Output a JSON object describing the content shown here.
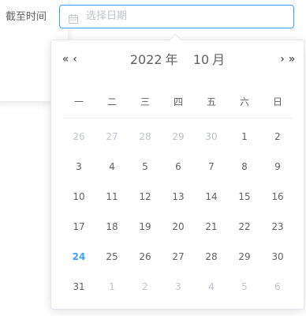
{
  "form": {
    "label": "截至时间",
    "input_placeholder": "选择日期",
    "input_icon": "calendar-icon"
  },
  "picker": {
    "year": "2022",
    "year_suffix": "年",
    "month": "10",
    "month_suffix": "月",
    "nav": {
      "prev_year": "«",
      "prev_month": "‹",
      "next_month": "›",
      "next_year": "»"
    },
    "weekdays": [
      "一",
      "二",
      "三",
      "四",
      "五",
      "六",
      "日"
    ],
    "weeks": [
      [
        {
          "d": "26",
          "t": "prev"
        },
        {
          "d": "27",
          "t": "prev"
        },
        {
          "d": "28",
          "t": "prev"
        },
        {
          "d": "29",
          "t": "prev"
        },
        {
          "d": "30",
          "t": "prev"
        },
        {
          "d": "1",
          "t": "cur"
        },
        {
          "d": "2",
          "t": "cur"
        }
      ],
      [
        {
          "d": "3",
          "t": "cur"
        },
        {
          "d": "4",
          "t": "cur"
        },
        {
          "d": "5",
          "t": "cur"
        },
        {
          "d": "6",
          "t": "cur"
        },
        {
          "d": "7",
          "t": "cur"
        },
        {
          "d": "8",
          "t": "cur"
        },
        {
          "d": "9",
          "t": "cur"
        }
      ],
      [
        {
          "d": "10",
          "t": "cur"
        },
        {
          "d": "11",
          "t": "cur"
        },
        {
          "d": "12",
          "t": "cur"
        },
        {
          "d": "13",
          "t": "cur"
        },
        {
          "d": "14",
          "t": "cur"
        },
        {
          "d": "15",
          "t": "cur"
        },
        {
          "d": "16",
          "t": "cur"
        }
      ],
      [
        {
          "d": "17",
          "t": "cur"
        },
        {
          "d": "18",
          "t": "cur"
        },
        {
          "d": "19",
          "t": "cur"
        },
        {
          "d": "20",
          "t": "cur"
        },
        {
          "d": "21",
          "t": "cur"
        },
        {
          "d": "22",
          "t": "cur"
        },
        {
          "d": "23",
          "t": "cur"
        }
      ],
      [
        {
          "d": "24",
          "t": "today"
        },
        {
          "d": "25",
          "t": "cur"
        },
        {
          "d": "26",
          "t": "cur"
        },
        {
          "d": "27",
          "t": "cur"
        },
        {
          "d": "28",
          "t": "cur"
        },
        {
          "d": "29",
          "t": "cur"
        },
        {
          "d": "30",
          "t": "cur"
        }
      ],
      [
        {
          "d": "31",
          "t": "cur"
        },
        {
          "d": "1",
          "t": "next"
        },
        {
          "d": "2",
          "t": "next"
        },
        {
          "d": "3",
          "t": "next"
        },
        {
          "d": "4",
          "t": "next"
        },
        {
          "d": "5",
          "t": "next"
        },
        {
          "d": "6",
          "t": "next"
        }
      ]
    ]
  },
  "colors": {
    "accent": "#409eff",
    "text": "#606266",
    "muted": "#c0c4cc",
    "border": "#e4e7ed"
  }
}
